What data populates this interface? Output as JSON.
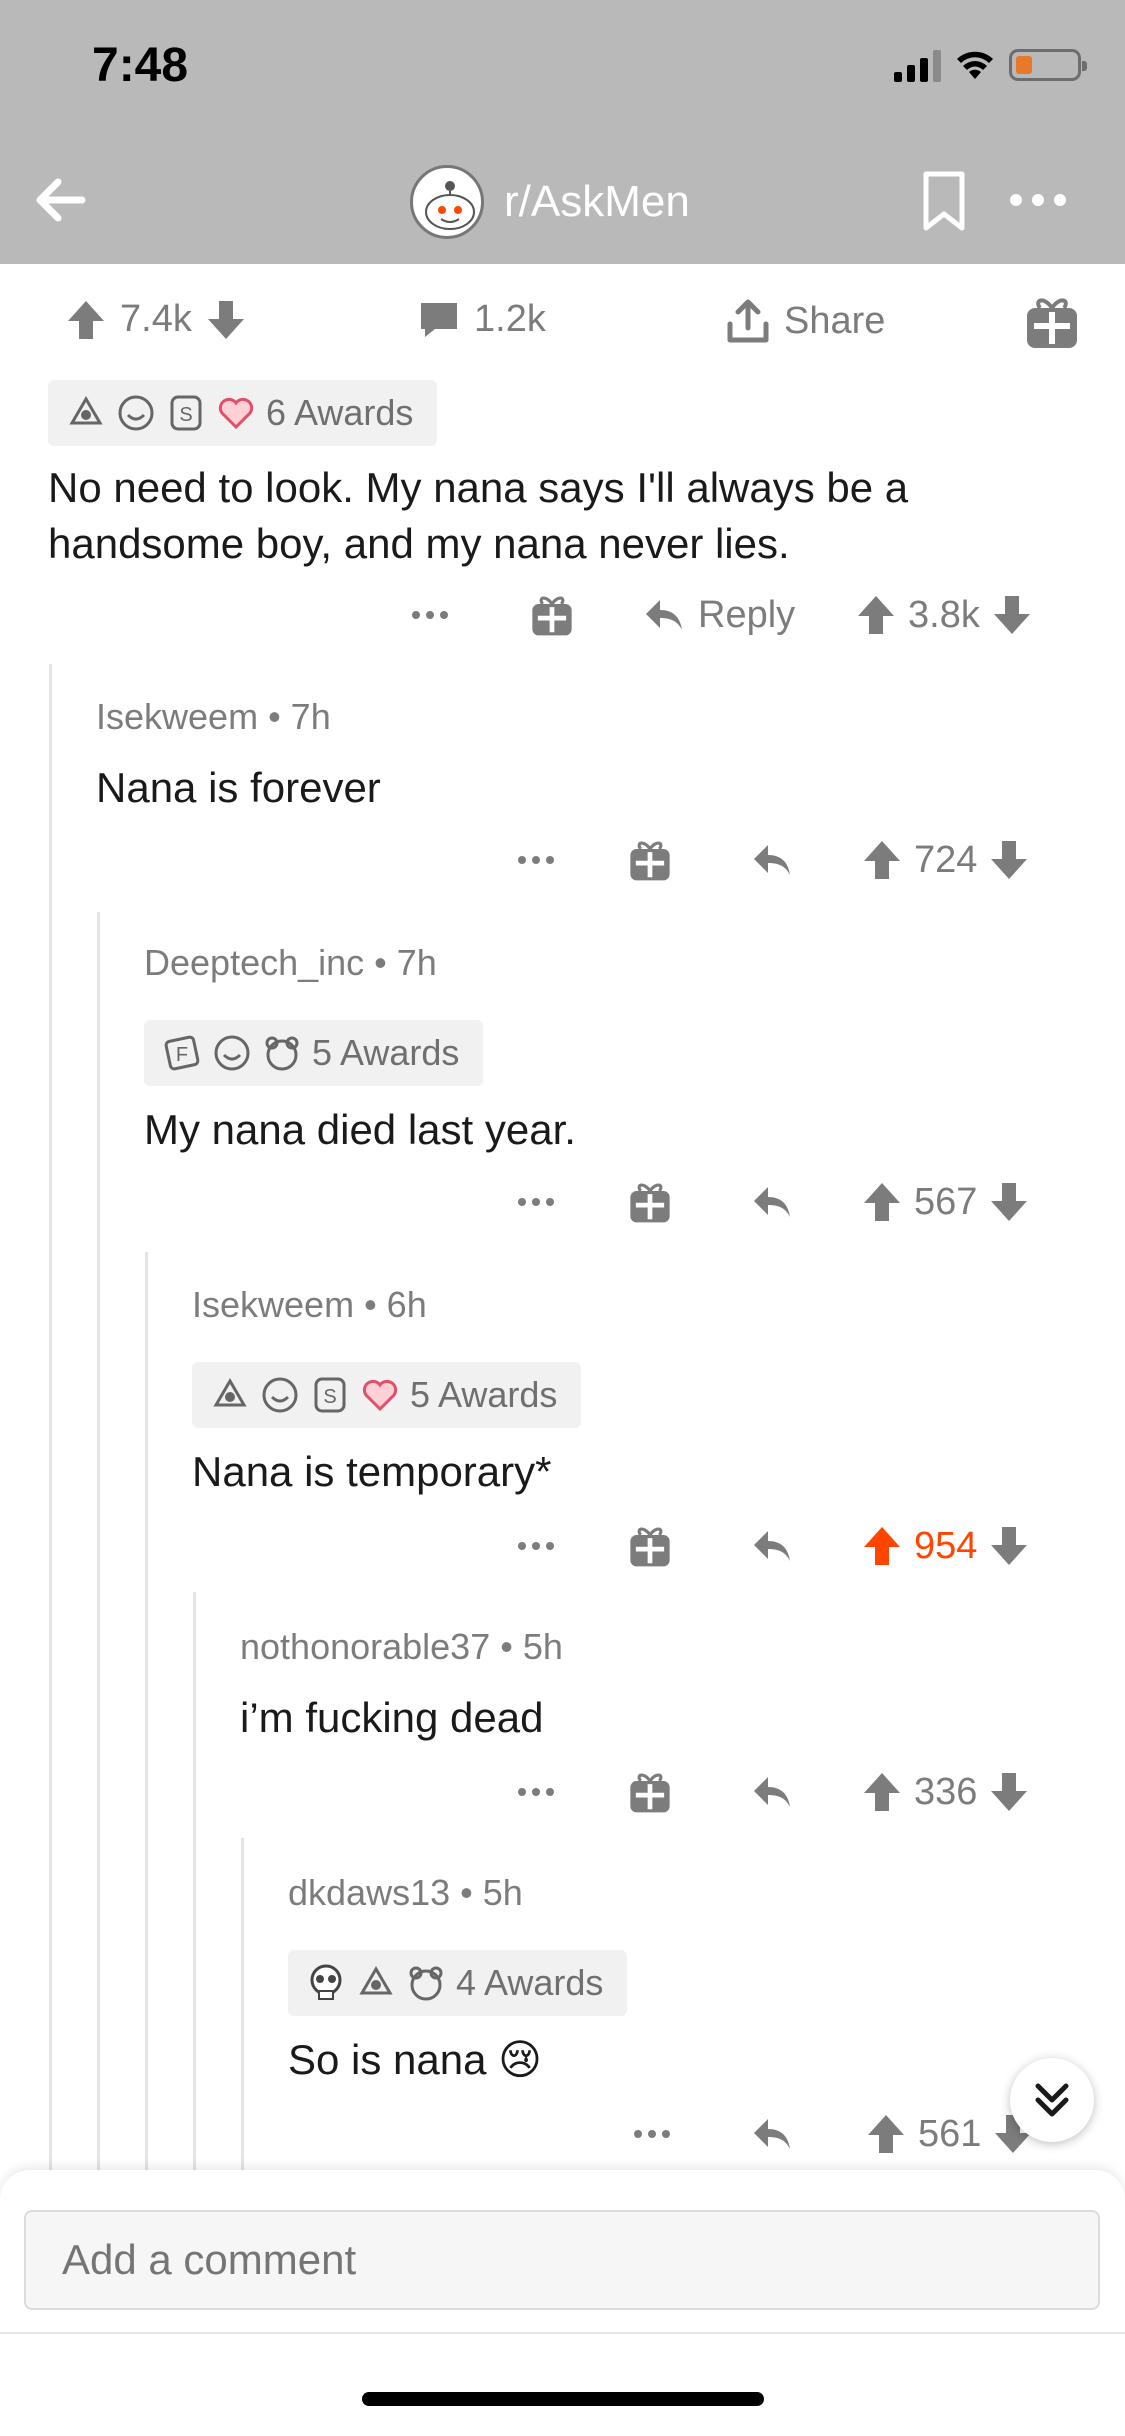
{
  "status": {
    "time": "7:48"
  },
  "header": {
    "subreddit": "r/AskMen"
  },
  "post_bar": {
    "votes": "7.4k",
    "comments": "1.2k",
    "share_label": "Share"
  },
  "comments": [
    {
      "awards_label": "6 Awards",
      "text": "No need to look. My nana says I'll always be a handsome boy, and my nana never lies.",
      "reply_label": "Reply",
      "score": "3.8k"
    },
    {
      "author": "Isekweem",
      "time": "7h",
      "text": "Nana is forever",
      "score": "724"
    },
    {
      "author": "Deeptech_inc",
      "time": "7h",
      "awards_label": "5 Awards",
      "text": "My nana died last year.",
      "score": "567"
    },
    {
      "author": "Isekweem",
      "time": "6h",
      "awards_label": "5 Awards",
      "text": "Nana is temporary*",
      "score": "954",
      "upvoted": true
    },
    {
      "author": "nothonorable37",
      "time": "5h",
      "text": "i’m fucking dead",
      "score": "336"
    },
    {
      "author": "dkdaws13",
      "time": "5h",
      "awards_label": "4 Awards",
      "text": "So is nana 😢",
      "score": "561"
    }
  ],
  "comment_bar": {
    "placeholder": "Add a comment"
  },
  "colors": {
    "upvote_active": "#ff4500",
    "header_bg": "#b9b9b9",
    "muted": "#7c7c7c"
  },
  "icons": [
    "back-arrow-icon",
    "snoo-icon",
    "bookmark-icon",
    "more-icon",
    "upvote-icon",
    "downvote-icon",
    "comment-icon",
    "share-icon",
    "gift-icon",
    "reply-icon",
    "chevron-double-down-icon"
  ]
}
